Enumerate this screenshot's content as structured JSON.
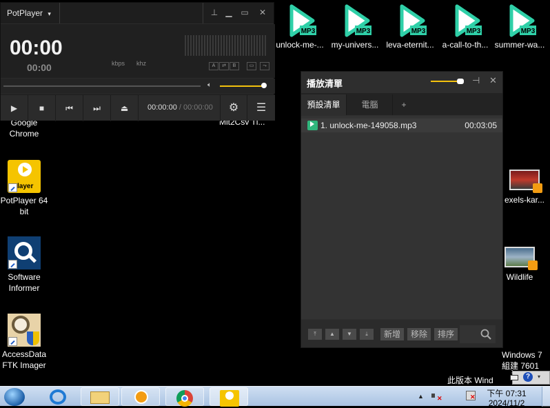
{
  "desktop": {
    "left_icons": [
      {
        "label": "Google\nChrome",
        "name": "desktop-icon-google-chrome"
      },
      {
        "label": "PotPlayer 64\nbit",
        "name": "desktop-icon-potplayer"
      },
      {
        "label": "Software\nInformer",
        "name": "desktop-icon-software-informer"
      },
      {
        "label": "AccessData\nFTK Imager",
        "name": "desktop-icon-ftk-imager"
      }
    ],
    "potplayer_icon_text": "layer",
    "mp3_badge": "MP3",
    "mp3_files": [
      "unlock-me-...",
      "my-univers...",
      "leva-eternit...",
      "a-call-to-th...",
      "summer-wa..."
    ],
    "partial_label": "Mlt2Csv Tl...",
    "right_icons": [
      {
        "label": "exels-kar..."
      },
      {
        "label": "Wildlife"
      }
    ],
    "windows_text": "Windows 7",
    "build_text": "組建 7601",
    "notice_text": "此版本 Wind"
  },
  "potplayer": {
    "brand": "PotPlayer",
    "time_main": "00:00",
    "time_sub": "00:00",
    "kbps": "kbps",
    "khz": "khz",
    "mini_buttons": [
      "A",
      "⇄",
      "B",
      "▭",
      "⤳"
    ],
    "current_time": "00:00:00",
    "separator": "/",
    "total_time": "00:00:00",
    "volume_level_percent": 100,
    "accent": "#f4c20d"
  },
  "playlist": {
    "title": "播放清單",
    "tabs": [
      "預設清單",
      "電腦",
      "+"
    ],
    "items": [
      {
        "title": "1. unlock-me-149058.mp3",
        "duration": "00:03:05"
      }
    ],
    "buttons": {
      "add": "新增",
      "remove": "移除",
      "sort": "排序"
    },
    "item_badge": "MP3"
  },
  "taskbar": {
    "time": "下午 07:31",
    "date": "2024/11/2"
  }
}
